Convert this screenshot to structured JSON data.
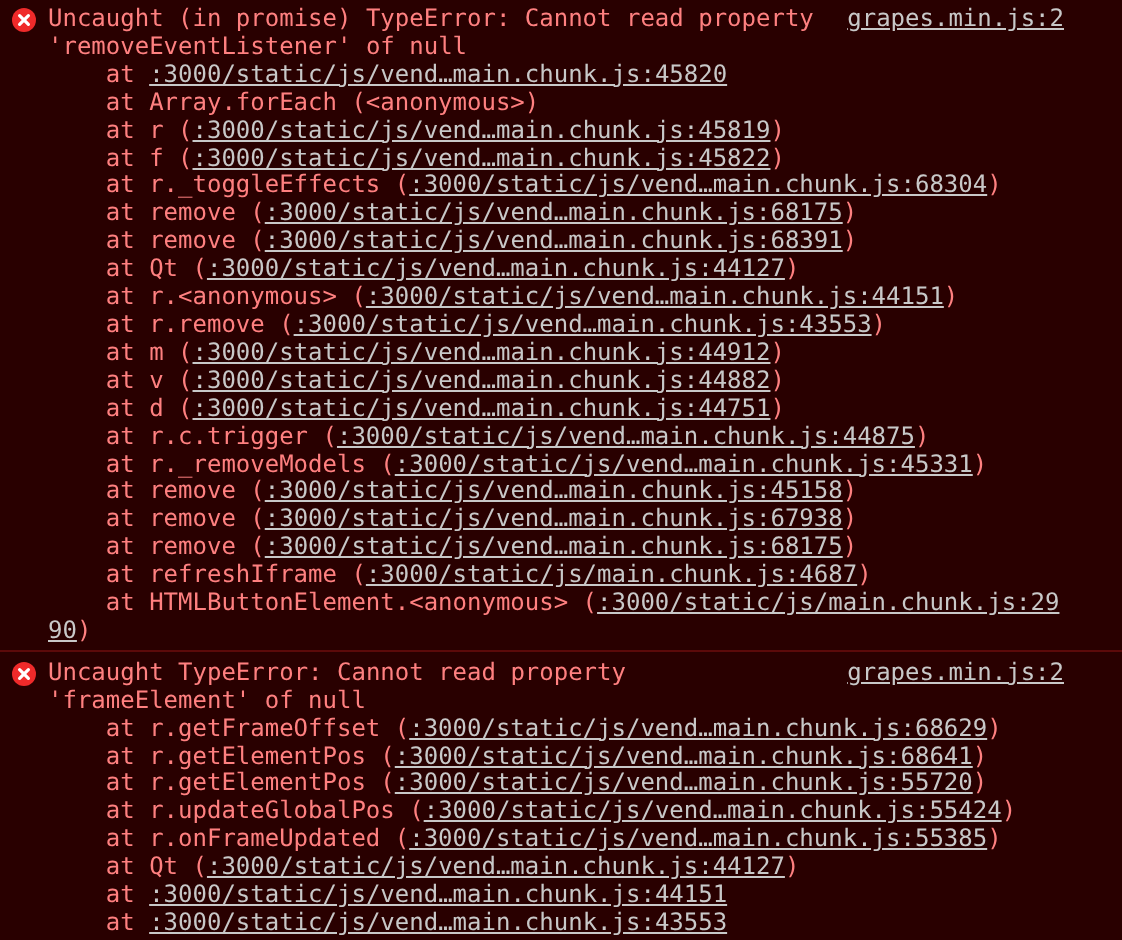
{
  "messages": [
    {
      "text": "Uncaught (in promise) TypeError: Cannot read property 'removeEventListener' of null",
      "source": "grapes.min.js:2",
      "frames": [
        {
          "before": "at ",
          "link": ":3000/static/js/vend…main.chunk.js:45820"
        },
        {
          "before": "at Array.forEach (<anonymous>)"
        },
        {
          "before": "at r (",
          "link": ":3000/static/js/vend…main.chunk.js:45819",
          "after": ")"
        },
        {
          "before": "at f (",
          "link": ":3000/static/js/vend…main.chunk.js:45822",
          "after": ")"
        },
        {
          "before": "at r._toggleEffects (",
          "link": ":3000/static/js/vend…main.chunk.js:68304",
          "after": ")"
        },
        {
          "before": "at remove (",
          "link": ":3000/static/js/vend…main.chunk.js:68175",
          "after": ")"
        },
        {
          "before": "at remove (",
          "link": ":3000/static/js/vend…main.chunk.js:68391",
          "after": ")"
        },
        {
          "before": "at Qt (",
          "link": ":3000/static/js/vend…main.chunk.js:44127",
          "after": ")"
        },
        {
          "before": "at r.<anonymous> (",
          "link": ":3000/static/js/vend…main.chunk.js:44151",
          "after": ")"
        },
        {
          "before": "at r.remove (",
          "link": ":3000/static/js/vend…main.chunk.js:43553",
          "after": ")"
        },
        {
          "before": "at m (",
          "link": ":3000/static/js/vend…main.chunk.js:44912",
          "after": ")"
        },
        {
          "before": "at v (",
          "link": ":3000/static/js/vend…main.chunk.js:44882",
          "after": ")"
        },
        {
          "before": "at d (",
          "link": ":3000/static/js/vend…main.chunk.js:44751",
          "after": ")"
        },
        {
          "before": "at r.c.trigger (",
          "link": ":3000/static/js/vend…main.chunk.js:44875",
          "after": ")"
        },
        {
          "before": "at r._removeModels (",
          "link": ":3000/static/js/vend…main.chunk.js:45331",
          "after": ")"
        },
        {
          "before": "at remove (",
          "link": ":3000/static/js/vend…main.chunk.js:45158",
          "after": ")"
        },
        {
          "before": "at remove (",
          "link": ":3000/static/js/vend…main.chunk.js:67938",
          "after": ")"
        },
        {
          "before": "at remove (",
          "link": ":3000/static/js/vend…main.chunk.js:68175",
          "after": ")"
        },
        {
          "before": "at refreshIframe (",
          "link": ":3000/static/js/main.chunk.js:4687",
          "after": ")"
        },
        {
          "before": "at HTMLButtonElement.<anonymous> (",
          "link": ":3000/static/js/main.chunk.js:29",
          "continuation": {
            "link": "90",
            "after": ")"
          }
        }
      ]
    },
    {
      "text": "Uncaught TypeError: Cannot read property 'frameElement' of null",
      "source": "grapes.min.js:2",
      "frames": [
        {
          "before": "at r.getFrameOffset (",
          "link": ":3000/static/js/vend…main.chunk.js:68629",
          "after": ")"
        },
        {
          "before": "at r.getElementPos (",
          "link": ":3000/static/js/vend…main.chunk.js:68641",
          "after": ")"
        },
        {
          "before": "at r.getElementPos (",
          "link": ":3000/static/js/vend…main.chunk.js:55720",
          "after": ")"
        },
        {
          "before": "at r.updateGlobalPos (",
          "link": ":3000/static/js/vend…main.chunk.js:55424",
          "after": ")"
        },
        {
          "before": "at r.onFrameUpdated (",
          "link": ":3000/static/js/vend…main.chunk.js:55385",
          "after": ")"
        },
        {
          "before": "at Qt (",
          "link": ":3000/static/js/vend…main.chunk.js:44127",
          "after": ")"
        },
        {
          "before": "at ",
          "link": ":3000/static/js/vend…main.chunk.js:44151"
        },
        {
          "before": "at ",
          "link": ":3000/static/js/vend…main.chunk.js:43553"
        }
      ]
    }
  ]
}
